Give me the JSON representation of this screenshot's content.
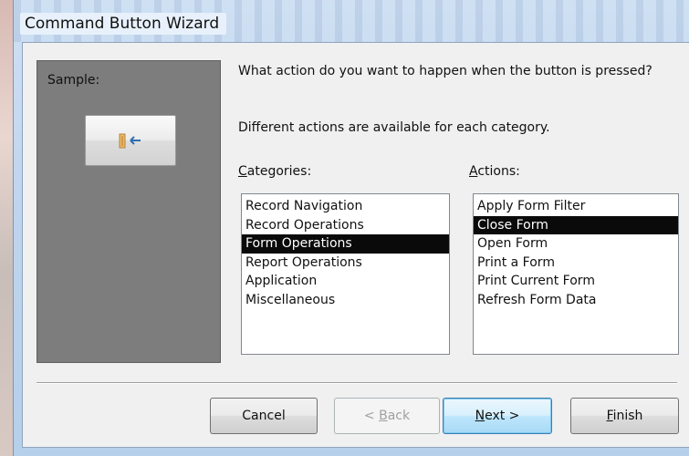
{
  "window": {
    "title": "Command Button Wizard"
  },
  "sample": {
    "label": "Sample:",
    "button_icon": "close-form-door-icon"
  },
  "prompts": {
    "question": "What action do you want to happen when the button is pressed?",
    "info": "Different actions are available for each category."
  },
  "categories": {
    "label_accel": "C",
    "label_rest": "ategories:",
    "items": [
      "Record Navigation",
      "Record Operations",
      "Form Operations",
      "Report Operations",
      "Application",
      "Miscellaneous"
    ],
    "selected": "Form Operations"
  },
  "actions": {
    "label_accel": "A",
    "label_rest": "ctions:",
    "items": [
      "Apply Form Filter",
      "Close Form",
      "Open Form",
      "Print a Form",
      "Print Current Form",
      "Refresh Form Data"
    ],
    "selected": "Close Form"
  },
  "buttons": {
    "cancel": "Cancel",
    "back_pre": "< ",
    "back_accel": "B",
    "back_rest": "ack",
    "next_accel": "N",
    "next_rest": "ext >",
    "finish_accel": "F",
    "finish_rest": "inish"
  },
  "colors": {
    "selection_bg": "#0a0a0a",
    "default_button_border": "#3c7fb1"
  }
}
